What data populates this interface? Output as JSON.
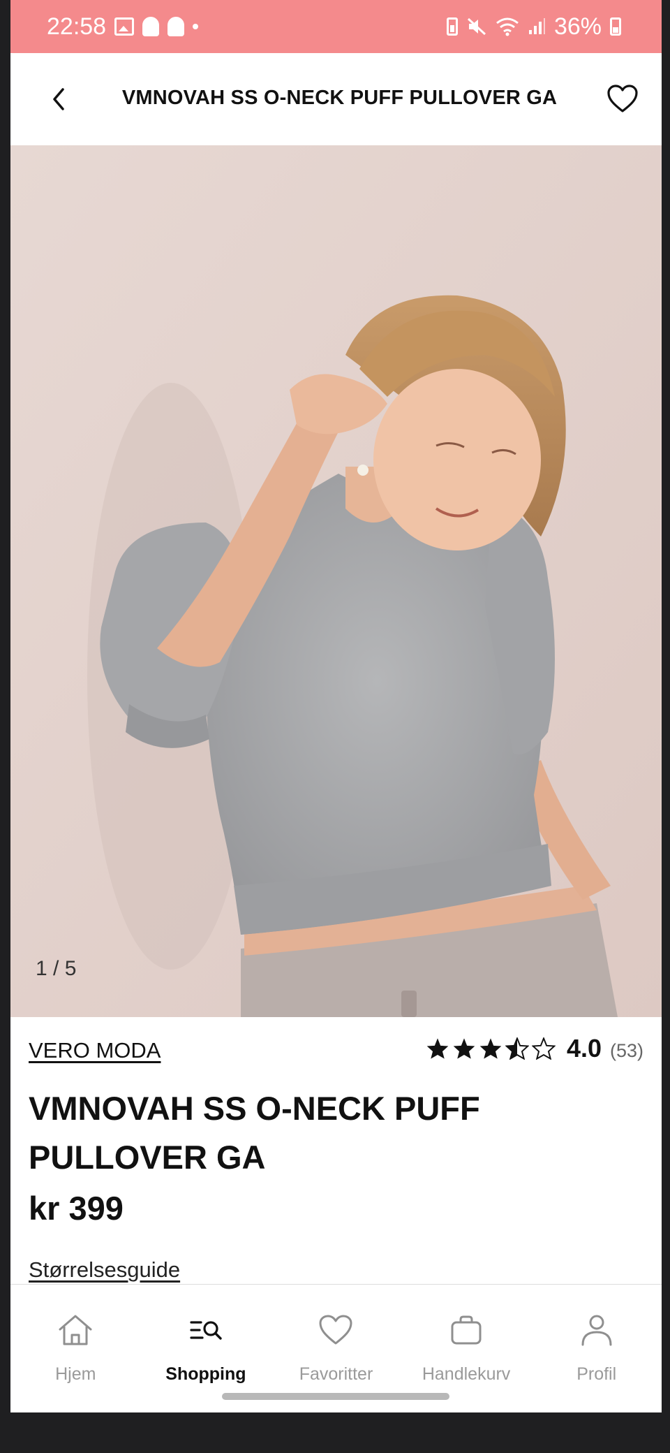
{
  "status_bar": {
    "time": "22:58",
    "battery": "36%"
  },
  "header": {
    "title": "VMNOVAH SS O-NECK PUFF PULLOVER GA"
  },
  "gallery": {
    "counter": "1 / 5"
  },
  "product": {
    "brand": "VERO MODA",
    "rating_value": "4.0",
    "rating_count": "(53)",
    "rating_stars": 3.5,
    "title": "VMNOVAH SS O-NECK PUFF PULLOVER GA",
    "price": "kr 399",
    "size_guide": "Størrelsesguide"
  },
  "bottom_nav": {
    "items": [
      {
        "label": "Hjem",
        "icon": "home-icon"
      },
      {
        "label": "Shopping",
        "icon": "shopping-search-icon"
      },
      {
        "label": "Favoritter",
        "icon": "heart-icon"
      },
      {
        "label": "Handlekurv",
        "icon": "bag-icon"
      },
      {
        "label": "Profil",
        "icon": "user-icon"
      }
    ],
    "active_index": 1
  },
  "colors": {
    "status_bar": "#f48a8c",
    "sweater": "#a8a9ab",
    "background_wall": "#e9dbd6"
  }
}
